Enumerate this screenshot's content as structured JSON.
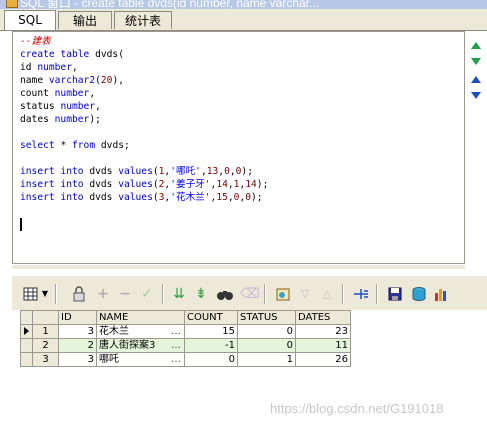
{
  "window": {
    "title": "SQL 窗口 - create table dvds(id number, name varchar..."
  },
  "tabs": [
    {
      "label": "SQL",
      "active": true
    },
    {
      "label": "输出",
      "active": false
    },
    {
      "label": "统计表",
      "active": false
    }
  ],
  "editor": {
    "lines": [
      [
        {
          "t": "--建表",
          "c": "cmt"
        }
      ],
      [
        {
          "t": "create table ",
          "c": "kw"
        },
        {
          "t": "dvds(",
          "c": "id"
        }
      ],
      [
        {
          "t": "id ",
          "c": "id"
        },
        {
          "t": "number",
          "c": "kw"
        },
        {
          "t": ",",
          "c": "id"
        }
      ],
      [
        {
          "t": "name ",
          "c": "id"
        },
        {
          "t": "varchar2",
          "c": "kw"
        },
        {
          "t": "(",
          "c": "id"
        },
        {
          "t": "20",
          "c": "num"
        },
        {
          "t": "),",
          "c": "id"
        }
      ],
      [
        {
          "t": "count ",
          "c": "id"
        },
        {
          "t": "number",
          "c": "kw"
        },
        {
          "t": ",",
          "c": "id"
        }
      ],
      [
        {
          "t": "status ",
          "c": "id"
        },
        {
          "t": "number",
          "c": "kw"
        },
        {
          "t": ",",
          "c": "id"
        }
      ],
      [
        {
          "t": "dates ",
          "c": "id"
        },
        {
          "t": "number",
          "c": "kw"
        },
        {
          "t": ");",
          "c": "id"
        }
      ],
      [],
      [
        {
          "t": "select ",
          "c": "kw"
        },
        {
          "t": "* ",
          "c": "id"
        },
        {
          "t": "from ",
          "c": "kw"
        },
        {
          "t": "dvds;",
          "c": "id"
        }
      ],
      [],
      [
        {
          "t": "insert into ",
          "c": "kw"
        },
        {
          "t": "dvds ",
          "c": "id"
        },
        {
          "t": "values",
          "c": "kw"
        },
        {
          "t": "(",
          "c": "id"
        },
        {
          "t": "1",
          "c": "num"
        },
        {
          "t": ",",
          "c": "id"
        },
        {
          "t": "'哪吒'",
          "c": "str"
        },
        {
          "t": ",",
          "c": "id"
        },
        {
          "t": "13",
          "c": "num"
        },
        {
          "t": ",",
          "c": "id"
        },
        {
          "t": "0",
          "c": "num"
        },
        {
          "t": ",",
          "c": "id"
        },
        {
          "t": "0",
          "c": "num"
        },
        {
          "t": ");",
          "c": "id"
        }
      ],
      [
        {
          "t": "insert into ",
          "c": "kw"
        },
        {
          "t": "dvds ",
          "c": "id"
        },
        {
          "t": "values",
          "c": "kw"
        },
        {
          "t": "(",
          "c": "id"
        },
        {
          "t": "2",
          "c": "num"
        },
        {
          "t": ",",
          "c": "id"
        },
        {
          "t": "'姜子牙'",
          "c": "str"
        },
        {
          "t": ",",
          "c": "id"
        },
        {
          "t": "14",
          "c": "num"
        },
        {
          "t": ",",
          "c": "id"
        },
        {
          "t": "1",
          "c": "num"
        },
        {
          "t": ",",
          "c": "id"
        },
        {
          "t": "14",
          "c": "num"
        },
        {
          "t": ");",
          "c": "id"
        }
      ],
      [
        {
          "t": "insert into ",
          "c": "kw"
        },
        {
          "t": "dvds ",
          "c": "id"
        },
        {
          "t": "values",
          "c": "kw"
        },
        {
          "t": "(",
          "c": "id"
        },
        {
          "t": "3",
          "c": "num"
        },
        {
          "t": ",",
          "c": "id"
        },
        {
          "t": "'花木兰'",
          "c": "str"
        },
        {
          "t": ",",
          "c": "id"
        },
        {
          "t": "15",
          "c": "num"
        },
        {
          "t": ",",
          "c": "id"
        },
        {
          "t": "0",
          "c": "num"
        },
        {
          "t": ",",
          "c": "id"
        },
        {
          "t": "0",
          "c": "num"
        },
        {
          "t": ");",
          "c": "id"
        }
      ]
    ]
  },
  "toolbar": {
    "icons": [
      "grid-view-icon",
      "lock-icon",
      "add-record-icon",
      "delete-record-icon",
      "post-record-icon",
      "fetch-next-icon",
      "fetch-last-icon",
      "query-by-example-icon",
      "clear-record-icon",
      "export-icon",
      "sort-descending-icon",
      "sort-ascending-icon",
      "connect-icon",
      "save-icon",
      "database-icon",
      "chart-icon"
    ]
  },
  "grid": {
    "columns": [
      "",
      "",
      "ID",
      "NAME",
      "COUNT",
      "STATUS",
      "DATES"
    ],
    "rows": [
      {
        "num": "1",
        "current": true,
        "id": "3",
        "name": "花木兰",
        "count": "15",
        "status": "0",
        "dates": "23"
      },
      {
        "num": "2",
        "current": false,
        "id": "2",
        "name": "唐人街探案3",
        "count": "-1",
        "status": "0",
        "dates": "11"
      },
      {
        "num": "3",
        "current": false,
        "id": "3",
        "name": "哪吒",
        "count": "0",
        "status": "1",
        "dates": "26"
      }
    ],
    "ellipsis": "…"
  },
  "watermark": "https://blog.csdn.net/G191018"
}
